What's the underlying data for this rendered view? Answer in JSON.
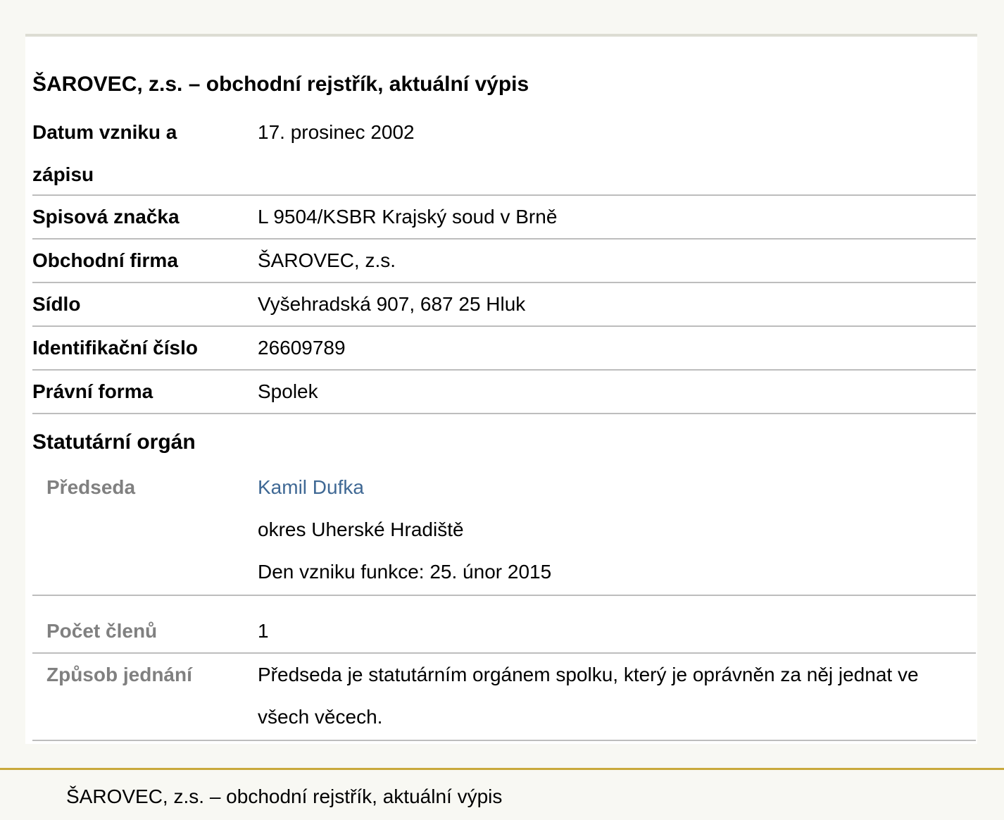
{
  "title": "ŠAROVEC, z.s. – obchodní rejstřík, aktuální výpis",
  "rows": [
    {
      "label": "Datum vzniku a zápisu",
      "value": "17. prosinec 2002"
    },
    {
      "label": "Spisová značka",
      "value": "L 9504/KSBR Krajský soud v Brně"
    },
    {
      "label": "Obchodní firma",
      "value": "ŠAROVEC, z.s."
    },
    {
      "label": "Sídlo",
      "value": "Vyšehradská 907, 687 25 Hluk"
    },
    {
      "label": "Identifikační číslo",
      "value": "26609789"
    },
    {
      "label": "Právní forma",
      "value": "Spolek"
    }
  ],
  "statutory": {
    "heading": "Statutární orgán",
    "chair": {
      "label": "Předseda",
      "name": "Kamil Dufka",
      "district": "okres Uherské Hradiště",
      "since": "Den vzniku funkce: 25. únor 2015"
    },
    "members": {
      "label": "Počet členů",
      "value": "1"
    },
    "acting": {
      "label": "Způsob jednání",
      "value": "Předseda je statutárním orgánem spolku, který je oprávněn za něj jednat ve všech věcech."
    }
  },
  "colors": {
    "link": "#3f6894",
    "sublabel": "#808080",
    "footer_border": "#c9a93c"
  },
  "footer": {
    "text": "ŠAROVEC, z.s. – obchodní rejstřík, aktuální výpis"
  }
}
